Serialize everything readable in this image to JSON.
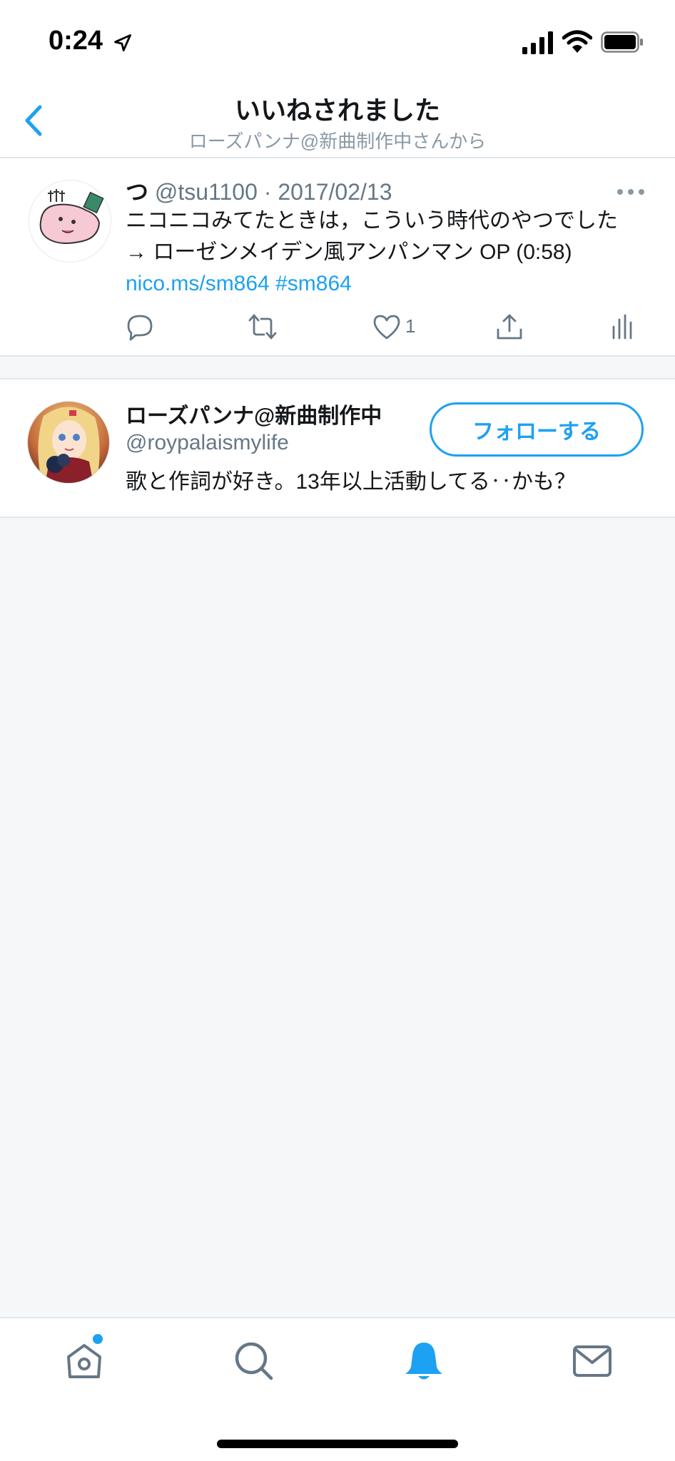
{
  "status_bar": {
    "time": "0:24"
  },
  "nav": {
    "title": "いいねされました",
    "subtitle": "ローズパンナ@新曲制作中さんから",
    "back_icon": "chevron-left-icon"
  },
  "tweet": {
    "name": "つ",
    "handle": "@tsu1100",
    "separator": "·",
    "date": "2017/02/13",
    "text_line1": "ニコニコみてたときは，こういう時代のやつでした",
    "text_line2": "→ ローゼンメイデン風アンパンマン OP (0:58)",
    "link1": "nico.ms/sm864",
    "link2": "#sm864",
    "like_count": "1",
    "actions": [
      "reply-icon",
      "retweet-icon",
      "like-icon",
      "share-icon",
      "analytics-icon"
    ]
  },
  "user": {
    "name": "ローズパンナ@新曲制作中",
    "handle": "@roypalaismylife",
    "bio": "歌と作詞が好き。13年以上活動してる‥かも？",
    "follow_label": "フォローする"
  },
  "tabbar": {
    "tabs": [
      "home-icon",
      "search-icon",
      "notifications-icon",
      "messages-icon"
    ],
    "active": "notifications-icon"
  },
  "colors": {
    "accent": "#1da1f2",
    "secondary_text": "#657786",
    "background": "#f5f7f9"
  }
}
